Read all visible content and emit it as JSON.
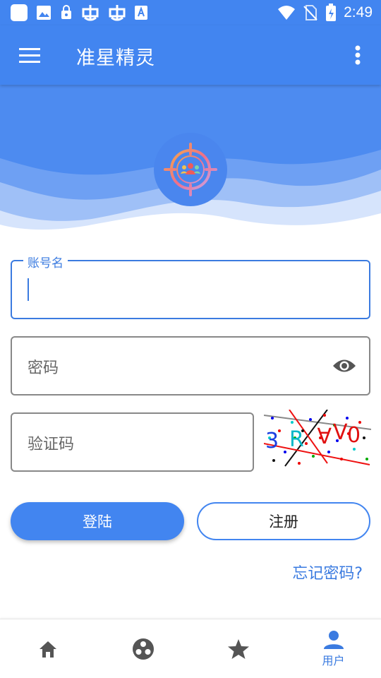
{
  "status_bar": {
    "time": "2:49",
    "icons": [
      "square-notification-icon",
      "image-icon",
      "lock-icon",
      "bug-icon",
      "bug-icon",
      "font-icon",
      "wifi-icon",
      "no-sim-icon",
      "battery-charging-icon"
    ]
  },
  "app_bar": {
    "title": "准星精灵",
    "menu_icon": "hamburger-menu-icon",
    "more_icon": "more-vert-icon"
  },
  "header": {
    "logo_icon": "crosshair-group-icon"
  },
  "form": {
    "account": {
      "label": "账号名",
      "value": ""
    },
    "password": {
      "placeholder": "密码",
      "toggle_icon": "eye-icon"
    },
    "captcha": {
      "placeholder": "验证码",
      "image_text": "3RAV0"
    }
  },
  "actions": {
    "login": "登陆",
    "register": "注册",
    "forgot_password": "忘记密码?"
  },
  "bottom_nav": {
    "items": [
      {
        "icon": "home-icon",
        "label": ""
      },
      {
        "icon": "circles-icon",
        "label": ""
      },
      {
        "icon": "star-icon",
        "label": ""
      },
      {
        "icon": "user-icon",
        "label": "用户",
        "active": true
      }
    ]
  },
  "colors": {
    "primary": "#4285f0",
    "accent_text": "#3b7be0",
    "wave_light": "#c7dafb"
  }
}
